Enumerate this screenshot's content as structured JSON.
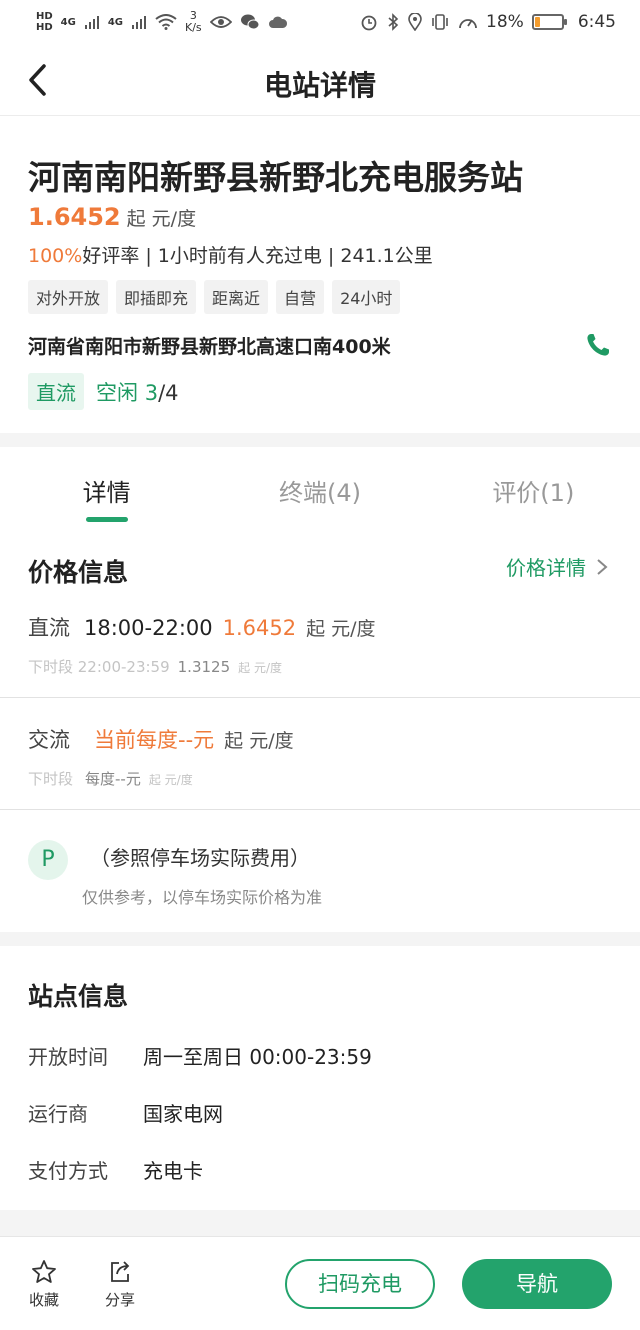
{
  "status_bar": {
    "hd1": "HD",
    "hd2": "HD",
    "sim1_net": "4G",
    "sim2_net": "4G",
    "speed_value": "3",
    "speed_unit": "K/s",
    "battery_percent": "18%",
    "time": "6:45"
  },
  "nav": {
    "title": "电站详情"
  },
  "station": {
    "name": "河南南阳新野县新野北充电服务站",
    "price": "1.6452",
    "price_unit": "起 元/度",
    "rating_value": "100%",
    "meta_text": "好评率 | 1小时前有人充过电 | 241.1公里",
    "tags": [
      "对外开放",
      "即插即充",
      "距离近",
      "自营",
      "24小时"
    ],
    "address": "河南省南阳市新野县新野北高速口南400米",
    "type_badge": "直流",
    "idle_label": "空闲",
    "idle_available": "3",
    "idle_total": "/4"
  },
  "tabs": [
    {
      "label": "详情"
    },
    {
      "label": "终端(4)"
    },
    {
      "label": "评价(1)"
    }
  ],
  "price_info": {
    "title": "价格信息",
    "detail_link": "价格详情",
    "dc": {
      "type": "直流",
      "time": "18:00-22:00",
      "price": "1.6452",
      "unit": "起 元/度",
      "next_label": "下时段 22:00-23:59",
      "next_price": "1.3125",
      "next_unit": "起 元/度"
    },
    "ac": {
      "type": "交流",
      "price": "当前每度--元",
      "unit": "起 元/度",
      "next_label": "下时段",
      "next_price": "每度--元",
      "next_unit": "起 元/度"
    },
    "parking": {
      "icon_letter": "P",
      "text": "（参照停车场实际费用）",
      "note": "仅供参考，以停车场实际价格为准"
    }
  },
  "site_info": {
    "title": "站点信息",
    "rows": [
      {
        "label": "开放时间",
        "value": "周一至周日 00:00-23:59"
      },
      {
        "label": "运行商",
        "value": "国家电网"
      },
      {
        "label": "支付方式",
        "value": "充电卡"
      }
    ]
  },
  "bottom_bar": {
    "favorite_label": "收藏",
    "share_label": "分享",
    "scan_button": "扫码充电",
    "navigate_button": "导航"
  },
  "colors": {
    "accent_green": "#23a36c",
    "price_orange": "#ef7a3a"
  }
}
